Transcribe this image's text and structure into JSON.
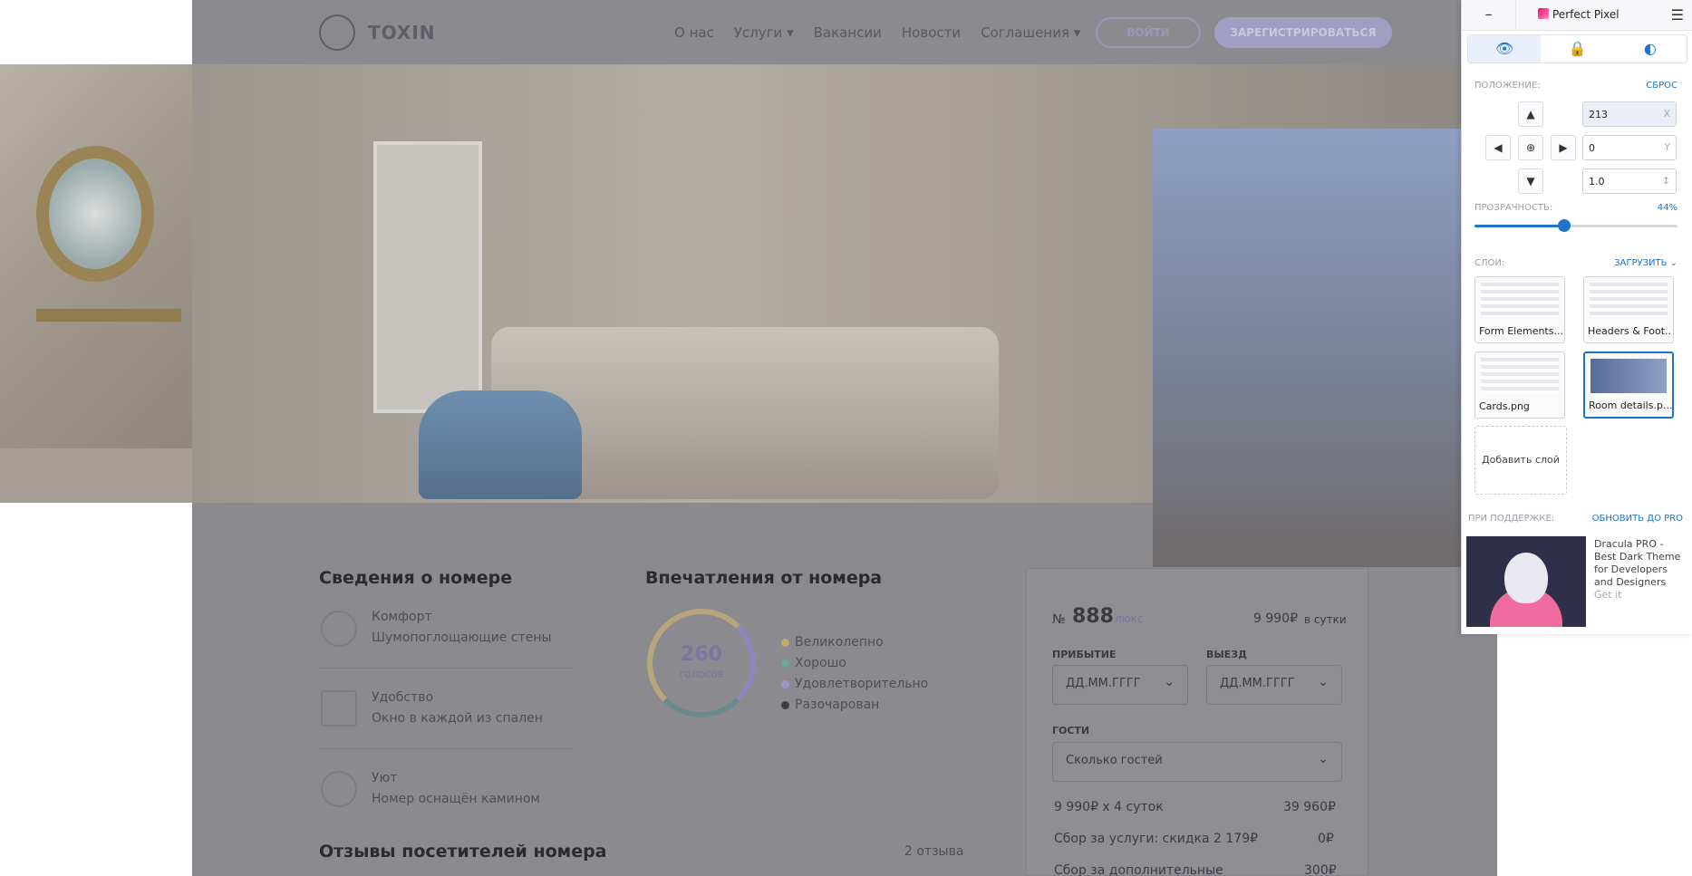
{
  "site": {
    "logo_text": "TOXIN",
    "nav": [
      "О нас",
      "Услуги ▾",
      "Вакансии",
      "Новости",
      "Соглашения ▾"
    ],
    "login": "ВОЙТИ",
    "register": "ЗАРЕГИСТРИРОВАТЬСЯ"
  },
  "room_info": {
    "title": "Сведения о номере",
    "features": [
      {
        "title": "Комфорт",
        "sub": "Шумопоглощающие стены"
      },
      {
        "title": "Удобство",
        "sub": "Окно в каждой из спален"
      },
      {
        "title": "Уют",
        "sub": "Номер оснащён камином"
      }
    ]
  },
  "impressions": {
    "title": "Впечатления от номера",
    "votes": "260",
    "votes_label": "голосов",
    "legend": [
      {
        "label": "Великолепно",
        "color": "#c9a86a"
      },
      {
        "label": "Хорошо",
        "color": "#6aa89a"
      },
      {
        "label": "Удовлетворительно",
        "color": "#9c97c8"
      },
      {
        "label": "Разочарован",
        "color": "#3d3b44"
      }
    ]
  },
  "reviews": {
    "title": "Отзывы посетителей номера",
    "count": "2 отзыва"
  },
  "booking": {
    "num_prefix": "№",
    "number": "888",
    "type": "люкс",
    "price": "9 990₽",
    "per": "в сутки",
    "arrival_label": "ПРИБЫТИЕ",
    "departure_label": "ВЫЕЗД",
    "date_placeholder": "ДД.ММ.ГГГГ",
    "guests_label": "ГОСТИ",
    "guests_placeholder": "Сколько гостей",
    "line1_left": "9 990₽ х 4 суток",
    "line1_right": "39 960₽",
    "line2_left": "Сбор за услуги: скидка 2 179₽",
    "line2_right": "0₽",
    "line3_left": "Сбор за дополнительные",
    "line3_right": "300₽"
  },
  "pp": {
    "min": "–",
    "title": "Perfect Pixel",
    "menu": "☰",
    "position_label": "ПОЛОЖЕНИЕ:",
    "reset": "СБРОС",
    "x_value": "213",
    "x_unit": "X",
    "y_value": "0",
    "y_unit": "Y",
    "scale_value": "1.0",
    "scale_unit": "↕",
    "opacity_label": "ПРОЗРАЧНОСТЬ:",
    "opacity_value": "44%",
    "opacity": 0.44,
    "layers_label": "СЛОИ:",
    "upload": "ЗАГРУЗИТЬ ⌄",
    "layers": [
      "Form Elements...",
      "Headers & Foot...",
      "Cards.png",
      "Room details.p..."
    ],
    "add_layer": "Добавить слой",
    "support_label": "ПРИ ПОДДЕРЖКЕ:",
    "upgrade": "ОБНОВИТЬ ДО PRO",
    "ad_text": "Dracula PRO - Best Dark Theme for Developers and Designers",
    "ad_get": "Get it"
  }
}
